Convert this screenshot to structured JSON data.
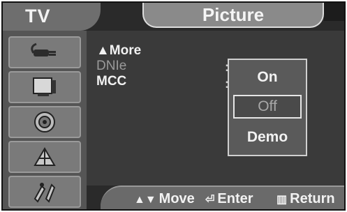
{
  "header": {
    "source_label": "TV",
    "title": "Picture"
  },
  "sidebar": {
    "items": [
      {
        "icon": "input-plug-icon"
      },
      {
        "icon": "picture-screen-icon"
      },
      {
        "icon": "sound-speaker-icon"
      },
      {
        "icon": "channel-antenna-icon"
      },
      {
        "icon": "setup-tools-icon"
      }
    ]
  },
  "menu": {
    "items": [
      {
        "label": "▲More"
      },
      {
        "label": "DNIe"
      },
      {
        "label": "MCC"
      }
    ]
  },
  "options": {
    "items": [
      "On",
      "Off",
      "Demo"
    ],
    "selected": "Off"
  },
  "footer": {
    "move": "Move",
    "enter": "Enter",
    "return": "Return"
  }
}
